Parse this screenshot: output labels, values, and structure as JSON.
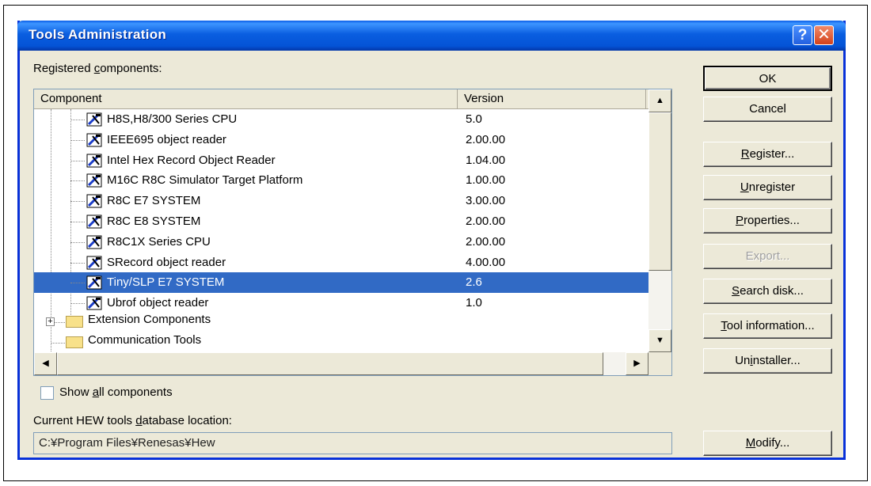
{
  "window": {
    "title": "Tools Administration",
    "help_glyph": "?",
    "close_glyph": "✕"
  },
  "registered_label_a": "Registered ",
  "registered_label_u": "c",
  "registered_label_b": "omponents:",
  "columns": {
    "component": "Component",
    "version": "Version"
  },
  "components": [
    {
      "name": "H8S,H8/300 Series CPU",
      "version": "5.0"
    },
    {
      "name": "IEEE695 object reader",
      "version": "2.00.00"
    },
    {
      "name": "Intel Hex Record Object Reader",
      "version": "1.04.00"
    },
    {
      "name": "M16C R8C Simulator Target Platform",
      "version": "1.00.00"
    },
    {
      "name": "R8C E7 SYSTEM",
      "version": "3.00.00"
    },
    {
      "name": "R8C E8 SYSTEM",
      "version": "2.00.00"
    },
    {
      "name": "R8C1X Series CPU",
      "version": "2.00.00"
    },
    {
      "name": "SRecord object reader",
      "version": "4.00.00"
    },
    {
      "name": "Tiny/SLP E7 SYSTEM",
      "version": "2.6",
      "selected": true
    },
    {
      "name": "Ubrof object reader",
      "version": "1.0"
    }
  ],
  "groups": {
    "extension": "Extension Components",
    "communication": "Communication Tools"
  },
  "buttons": {
    "ok": "OK",
    "cancel": "Cancel",
    "register_u": "R",
    "register_rest": "egister...",
    "unregister_u": "U",
    "unregister_rest": "nregister",
    "properties_u": "P",
    "properties_rest": "roperties...",
    "export": "Export...",
    "search_u": "S",
    "search_rest": "earch disk...",
    "tool_u": "T",
    "tool_rest": "ool information...",
    "uninst_a": "Un",
    "uninst_u": "i",
    "uninst_b": "nstaller...",
    "modify_u": "M",
    "modify_rest": "odify..."
  },
  "show_all": {
    "a": "Show ",
    "u": "a",
    "b": "ll components",
    "checked": false
  },
  "db_label": {
    "a": "Current HEW tools ",
    "u": "d",
    "b": "atabase location:"
  },
  "db_path": "C:¥Program Files¥Renesas¥Hew"
}
